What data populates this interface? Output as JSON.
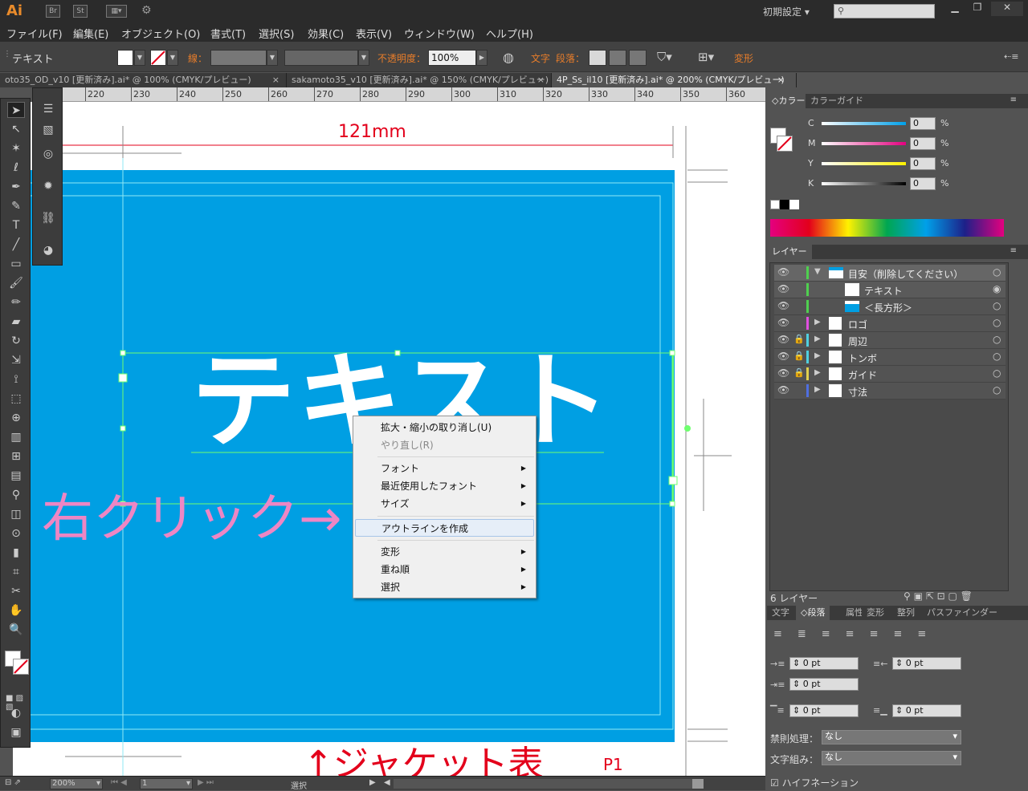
{
  "app": {
    "logo": "Ai",
    "icons": [
      "Br",
      "St"
    ],
    "workspace": "初期設定",
    "search_placeholder": ""
  },
  "menu": [
    "ファイル(F)",
    "編集(E)",
    "オブジェクト(O)",
    "書式(T)",
    "選択(S)",
    "効果(C)",
    "表示(V)",
    "ウィンドウ(W)",
    "ヘルプ(H)"
  ],
  "control": {
    "selection_label": "テキスト",
    "stroke_label": "線：",
    "opacity_label": "不透明度：",
    "opacity_value": "100%",
    "char_label": "文字",
    "para_label": "段落：",
    "transform_label": "変形"
  },
  "tabs": [
    "oto35_OD_v10 [更新済み].ai* @ 100% (CMYK/プレビュー)",
    "sakamoto35_v10 [更新済み].ai* @ 150% (CMYK/プレビュー)",
    "4P_Ss_il10 [更新済み].ai* @ 200% (CMYK/プレビュー)"
  ],
  "ruler": [
    "220",
    "230",
    "240",
    "250",
    "260",
    "270",
    "280",
    "290",
    "300",
    "310",
    "320",
    "330",
    "340",
    "350",
    "360"
  ],
  "canvas": {
    "dimension": "121mm",
    "main_text": "テキスト",
    "annotation": "右クリック→",
    "bottom_text": "↑ジャケット表",
    "page_label": "P1",
    "bg_color": "#009fe3",
    "annotation_color": "#ee86c4",
    "red_color": "#e3001b"
  },
  "context_menu": {
    "items": [
      {
        "label": "拡大・縮小の取り消し(U)",
        "enabled": true,
        "submenu": false
      },
      {
        "label": "やり直し(R)",
        "enabled": false,
        "submenu": false
      },
      {
        "label": "フォント",
        "enabled": true,
        "submenu": true
      },
      {
        "label": "最近使用したフォント",
        "enabled": true,
        "submenu": true
      },
      {
        "label": "サイズ",
        "enabled": true,
        "submenu": true
      },
      {
        "label": "アウトラインを作成",
        "enabled": true,
        "submenu": false,
        "highlighted": true
      },
      {
        "label": "変形",
        "enabled": true,
        "submenu": true
      },
      {
        "label": "重ね順",
        "enabled": true,
        "submenu": true
      },
      {
        "label": "選択",
        "enabled": true,
        "submenu": true
      }
    ]
  },
  "color_panel": {
    "tabs": [
      "カラー",
      "カラーガイド"
    ],
    "channels": [
      {
        "label": "C",
        "value": "0",
        "unit": "%",
        "color": "#00a0e9"
      },
      {
        "label": "M",
        "value": "0",
        "unit": "%",
        "color": "#e4007f"
      },
      {
        "label": "Y",
        "value": "0",
        "unit": "%",
        "color": "#fff100"
      },
      {
        "label": "K",
        "value": "0",
        "unit": "%",
        "color": "#000000"
      }
    ]
  },
  "layers_panel": {
    "title": "レイヤー",
    "rows": [
      {
        "name": "目安（削除してください）",
        "color": "#4fd04f",
        "expanded": true
      },
      {
        "name": "テキスト",
        "color": "#4fd04f"
      },
      {
        "name": "＜長方形＞",
        "color": "#4fd04f"
      },
      {
        "name": "ロゴ",
        "color": "#e04fe0"
      },
      {
        "name": "周辺",
        "color": "#4fd0e0"
      },
      {
        "name": "トンボ",
        "color": "#4fd0e0"
      },
      {
        "name": "ガイド",
        "color": "#e0d04f"
      },
      {
        "name": "寸法",
        "color": "#4f6fe0"
      }
    ],
    "count": "6 レイヤー"
  },
  "para_panel": {
    "tabs": [
      "文字",
      "段落",
      "属性",
      "変形",
      "整列",
      "パスファインダー"
    ],
    "fields": [
      "0 pt",
      "0 pt",
      "0 pt",
      "0 pt",
      "0 pt"
    ],
    "kinsoku_label": "禁則処理：",
    "kinsoku_value": "なし",
    "mojikumi_label": "文字組み：",
    "mojikumi_value": "なし",
    "hyphenation_label": "ハイフネーション"
  },
  "status": {
    "zoom": "200%",
    "page": "1",
    "tool": "選択"
  }
}
